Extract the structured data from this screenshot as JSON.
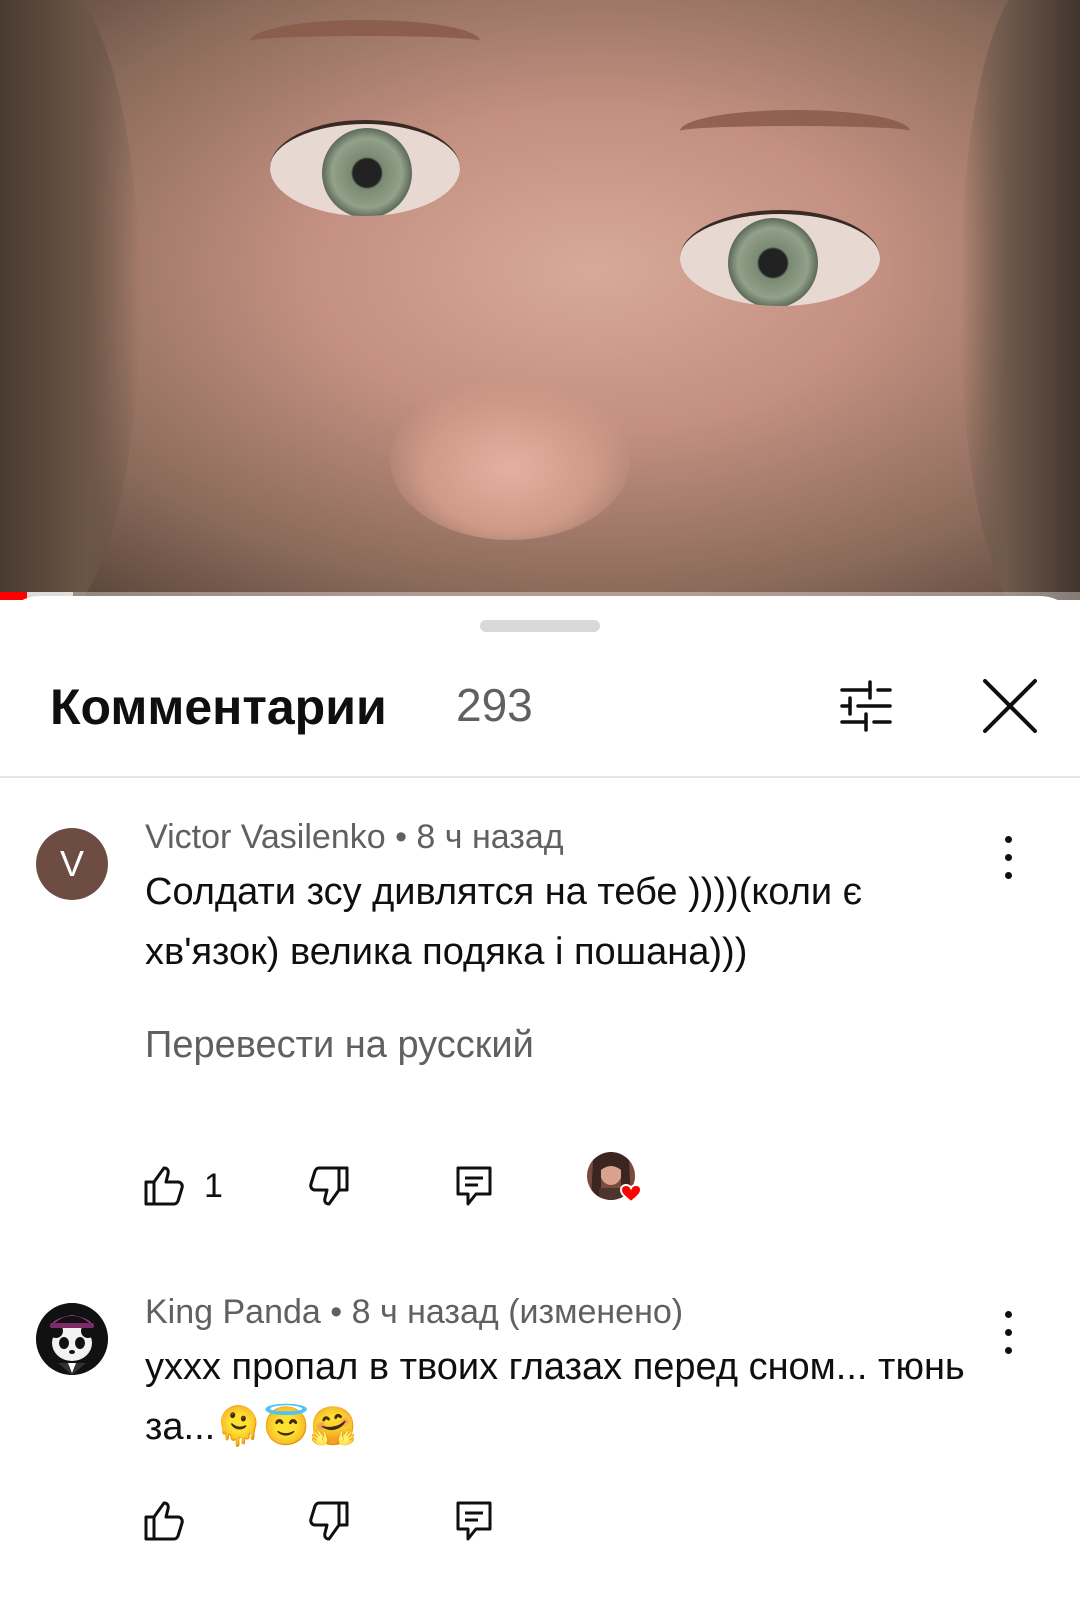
{
  "video": {
    "progress_played": 0.025,
    "progress_buffered": 0.068
  },
  "comments_panel": {
    "title": "Комментарии",
    "count": "293",
    "filter_icon": "sliders-icon",
    "close_icon": "close-icon"
  },
  "comments": [
    {
      "avatar_letter": "V",
      "avatar_color": "#6d4c41",
      "author": "Victor Vasilenko",
      "time": " • 8 ч назад",
      "text": "Солдати зсу дивлятся на тебе ))))(коли є хв'язок) велика подяка і пошана)))",
      "translate_label": "Перевести на русский",
      "likes": "1",
      "creator_heart": true
    },
    {
      "avatar_letter": "",
      "avatar_color": "#1a1a1a",
      "author": "King Panda",
      "time": " • 8 ч назад (изменено)",
      "text": "ухxx пропал в твоих глазах перед сном... тюнь за...🫠😇🤗",
      "likes": ""
    }
  ],
  "colors": {
    "like_heart": "#ff0000",
    "text_primary": "#0f0f0f",
    "text_secondary": "#606060"
  }
}
